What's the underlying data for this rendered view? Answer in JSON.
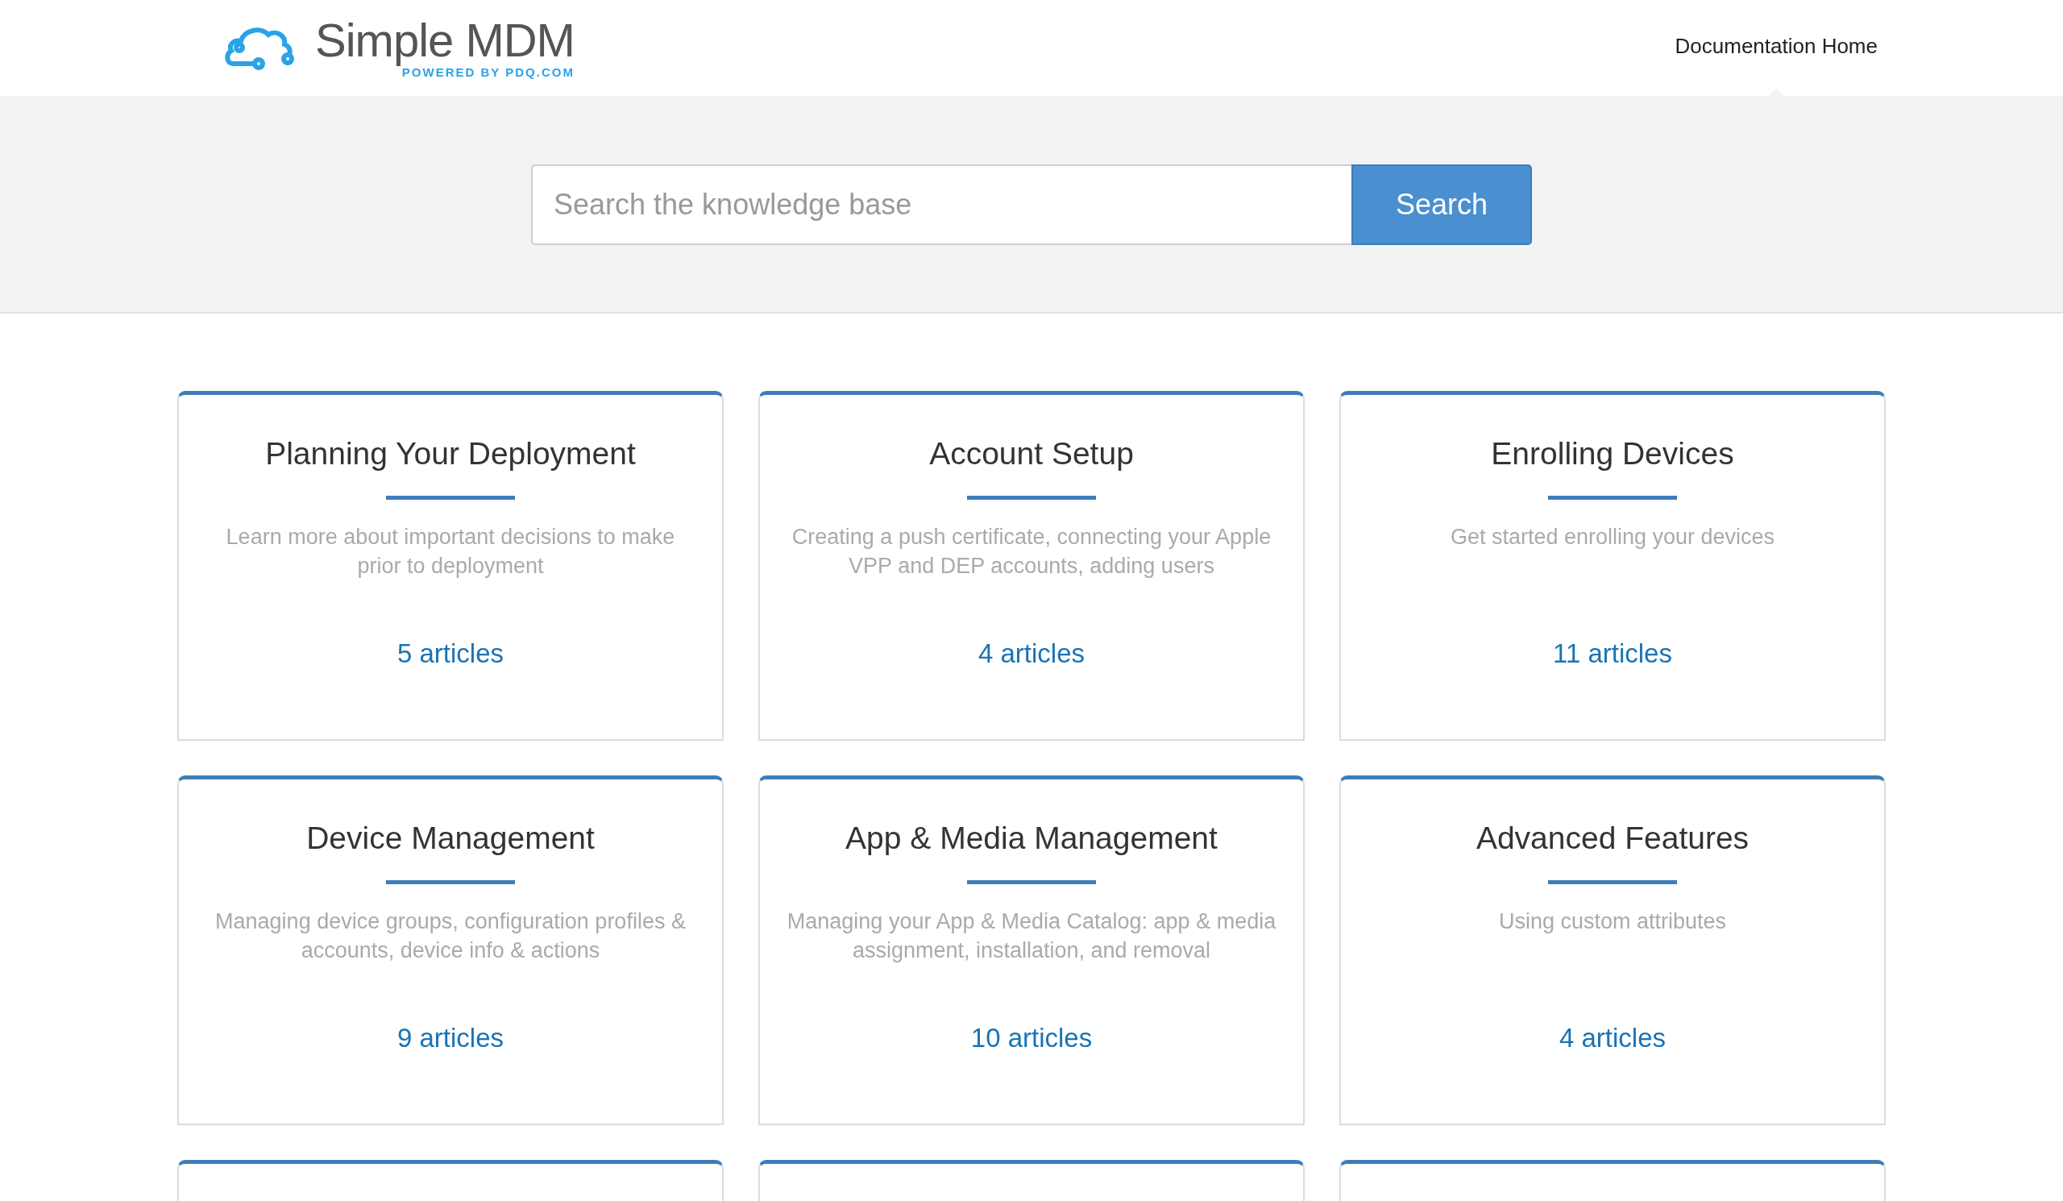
{
  "header": {
    "logo": {
      "name": "Simple MDM",
      "tagline": "POWERED BY PDQ.COM"
    },
    "nav": [
      {
        "label": "Documentation Home",
        "selected": true
      }
    ]
  },
  "search": {
    "placeholder": "Search the knowledge base",
    "button": "Search"
  },
  "categories": [
    {
      "title": "Planning Your Deployment",
      "description": "Learn more about important decisions to make prior to deployment",
      "articles": "5 articles"
    },
    {
      "title": "Account Setup",
      "description": "Creating a push certificate, connecting your Apple VPP and DEP accounts, adding users",
      "articles": "4 articles"
    },
    {
      "title": "Enrolling Devices",
      "description": "Get started enrolling your devices",
      "articles": "11 articles"
    },
    {
      "title": "Device Management",
      "description": "Managing device groups, configuration profiles & accounts, device info & actions",
      "articles": "9 articles"
    },
    {
      "title": "App & Media Management",
      "description": "Managing your App & Media Catalog: app & media assignment, installation, and removal",
      "articles": "10 articles"
    },
    {
      "title": "Advanced Features",
      "description": "Using custom attributes",
      "articles": "4 articles"
    }
  ]
}
